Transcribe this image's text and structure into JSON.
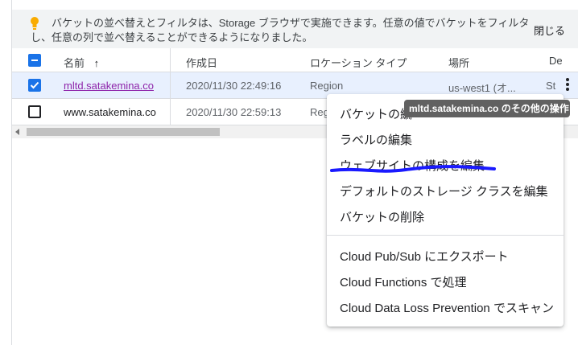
{
  "banner": {
    "message": "バケットの並べ替えとフィルタは、Storage ブラウザで実施できます。任意の値でバケットをフィルタし、任意の列で並べ替えることができるようになりました。",
    "close_label": "閉じる",
    "accent_color": "#f9ab00"
  },
  "table": {
    "columns": [
      "名前",
      "作成日",
      "ロケーション タイプ",
      "場所",
      "De"
    ],
    "sort_indicator": "↑",
    "rows": [
      {
        "name": "mltd.satakemina.co",
        "created": "2020/11/30 22:49:16",
        "location_type": "Region",
        "location": "us-west1 (オ...",
        "extra": "St",
        "checked": true
      },
      {
        "name": "www.satakemina.co",
        "created": "2020/11/30 22:59:13",
        "location_type": "Reg",
        "location": "",
        "extra": "",
        "checked": false
      }
    ]
  },
  "context_menu": {
    "items_top": [
      "バケットの編",
      "ラベルの編集",
      "ウェブサイトの構成を編集",
      "デフォルトのストレージ クラスを編集",
      "バケットの削除"
    ],
    "items_bottom": [
      "Cloud Pub/Sub にエクスポート",
      "Cloud Functions で処理",
      "Cloud Data Loss Prevention でスキャン"
    ]
  },
  "tooltip": "mltd.satakemina.co のその他の操作",
  "colors": {
    "primary": "#1a73e8",
    "link_visited": "#8e24aa",
    "annotation": "#1a1aff",
    "selected_row": "#e8f0fe"
  },
  "icons": {
    "bulb": "lightbulb-icon",
    "sort": "arrow-up-icon",
    "more": "more-vert-icon"
  }
}
